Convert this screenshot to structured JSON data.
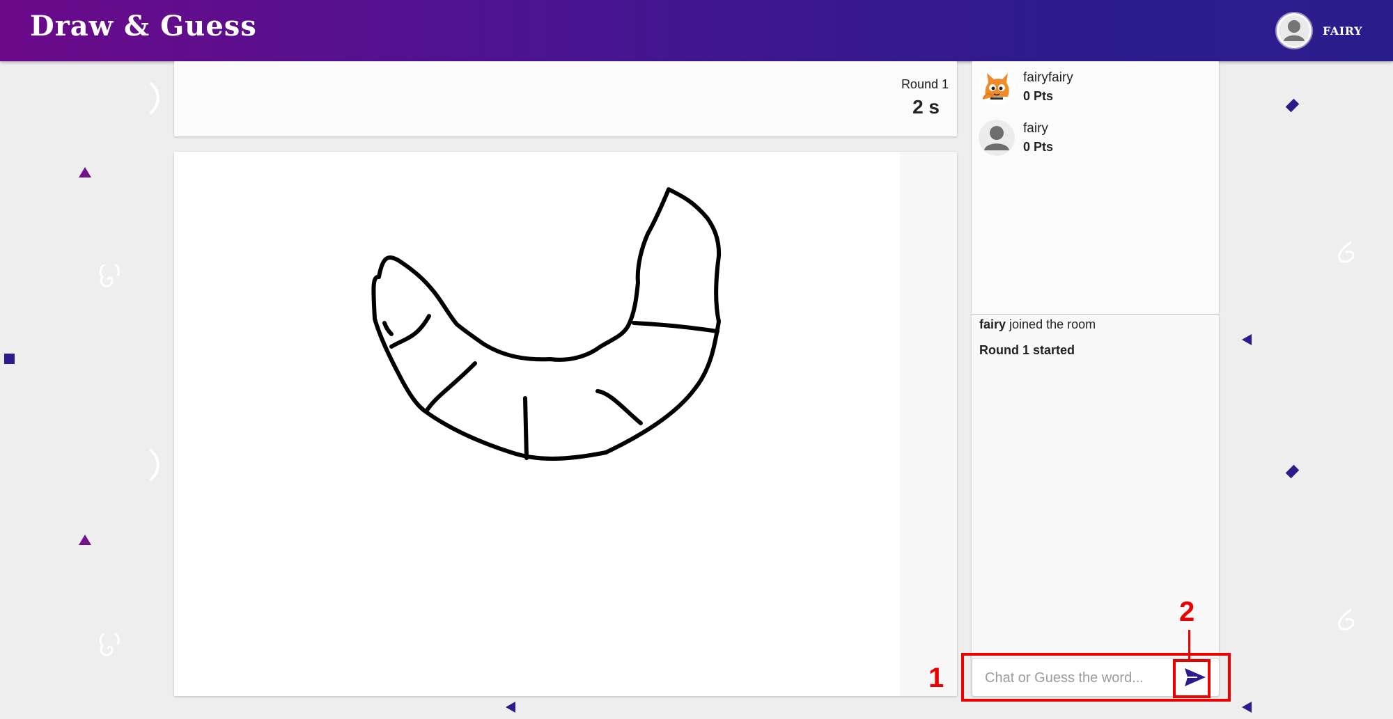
{
  "header": {
    "title": "Draw & Guess",
    "user_name": "FAIRY"
  },
  "round": {
    "label": "Round 1",
    "time": "2 s"
  },
  "players": [
    {
      "name": "fairyfairy",
      "points": "0 Pts",
      "avatar": "orange-cat-avatar"
    },
    {
      "name": "fairy",
      "points": "0 Pts",
      "avatar": "default-user-avatar"
    }
  ],
  "chat": {
    "messages": [
      {
        "user": "fairy",
        "text": " joined the room"
      },
      {
        "text": "Round 1 started"
      }
    ],
    "input_placeholder": "Chat or Guess the word...",
    "input_value": ""
  },
  "annotations": {
    "label_1": "1",
    "label_2": "2"
  },
  "colors": {
    "header_start": "#6b0a8a",
    "header_end": "#2b1c8c",
    "send_icon": "#2b1c8c",
    "annotation": "#ee0000"
  },
  "icons": {
    "send": "send-arrow-icon",
    "user": "user-avatar-icon"
  }
}
